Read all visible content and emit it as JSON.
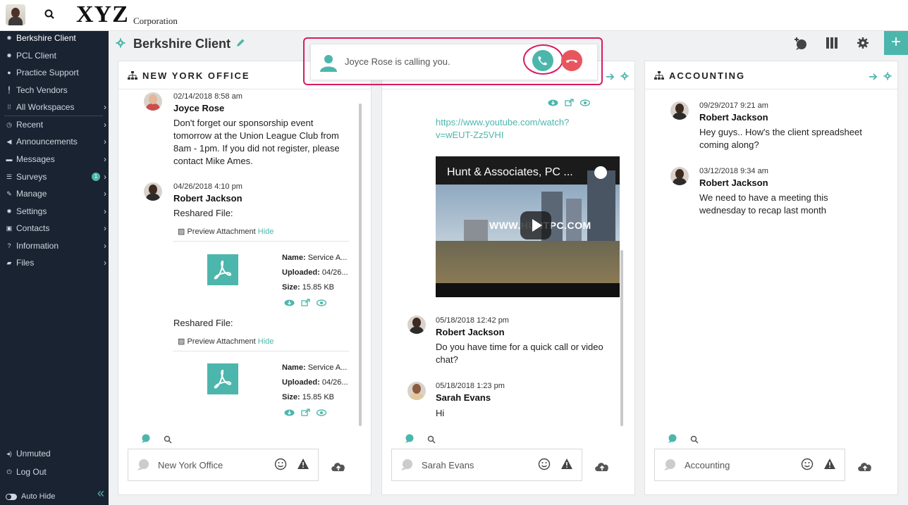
{
  "app": {
    "logo": "XYZ",
    "logo_sub": "Corporation"
  },
  "sidebar": {
    "items": [
      {
        "label": "Berkshire Client",
        "icon": "gear-icon"
      },
      {
        "label": "PCL Client",
        "icon": "gear-icon"
      },
      {
        "label": "Practice Support",
        "icon": "globe-icon"
      },
      {
        "label": "Tech Vendors",
        "icon": "pin-icon"
      },
      {
        "label": "All Workspaces",
        "icon": "grid-icon"
      },
      {
        "label": "Recent",
        "icon": "clock-icon"
      },
      {
        "label": "Announcements",
        "icon": "megaphone-icon"
      },
      {
        "label": "Messages",
        "icon": "chat-icon"
      },
      {
        "label": "Surveys",
        "icon": "list-icon",
        "badge": "1"
      },
      {
        "label": "Manage",
        "icon": "pencil-icon"
      },
      {
        "label": "Settings",
        "icon": "gear-icon"
      },
      {
        "label": "Contacts",
        "icon": "contact-icon"
      },
      {
        "label": "Information",
        "icon": "question-icon"
      },
      {
        "label": "Files",
        "icon": "folder-icon"
      }
    ],
    "unmuted": "Unmuted",
    "logout": "Log Out",
    "auto_hide": "Auto Hide"
  },
  "header": {
    "title": "Berkshire Client"
  },
  "call": {
    "text": "Joyce Rose is calling you."
  },
  "panels": {
    "ny": {
      "title": "NEW YORK OFFICE",
      "messages": [
        {
          "time": "02/14/2018 8:58 am",
          "name": "Joyce Rose",
          "body": "Don't forget our sponsorship event tomorrow at the Union League Club from 8am - 1pm.  If you did not register, please contact Mike Ames."
        },
        {
          "time": "04/26/2018 4:10 pm",
          "name": "Robert Jackson",
          "body": "Reshared File:"
        }
      ],
      "attachments": [
        {
          "reshared": "Reshared File:",
          "preview": "Preview Attachment",
          "hide": "Hide",
          "name_label": "Name:",
          "name": "Service A...",
          "uploaded_label": "Uploaded:",
          "uploaded": "04/26...",
          "size_label": "Size:",
          "size": "15.85 KB"
        },
        {
          "reshared": "Reshared File:",
          "preview": "Preview Attachment",
          "hide": "Hide",
          "name_label": "Name:",
          "name": "Service A...",
          "uploaded_label": "Uploaded:",
          "uploaded": "04/26...",
          "size_label": "Size:",
          "size": "15.85 KB"
        }
      ],
      "composer": "New York Office"
    },
    "mid": {
      "link": "https://www.youtube.com/watch?v=wEUT-Zz5VHI",
      "link_line1": "https://www.youtube.com/watch?",
      "link_line2": "v=wEUT-Zz5VHI",
      "video_title": "Hunt & Associates, PC ...",
      "video_watermark": "WWW.HUNTPC.COM",
      "messages": [
        {
          "time": "05/18/2018 12:42 pm",
          "name": "Robert Jackson",
          "body": "Do you have time for a quick call or video chat?"
        },
        {
          "time": "05/18/2018 1:23 pm",
          "name": "Sarah Evans",
          "body": "Hi"
        }
      ],
      "composer": "Sarah Evans"
    },
    "acct": {
      "title": "ACCOUNTING",
      "messages": [
        {
          "time": "09/29/2017 9:21 am",
          "name": "Robert Jackson",
          "body": "Hey guys.. How's the client spreadsheet coming along?"
        },
        {
          "time": "03/12/2018 9:34 am",
          "name": "Robert Jackson",
          "body": "We need to have a meeting this wednesday to recap last month"
        }
      ],
      "composer": "Accounting"
    }
  },
  "colors": {
    "accent": "#4db6ac",
    "sidebar": "#1a2332",
    "highlight": "#d81b60",
    "decline": "#e8555f"
  }
}
